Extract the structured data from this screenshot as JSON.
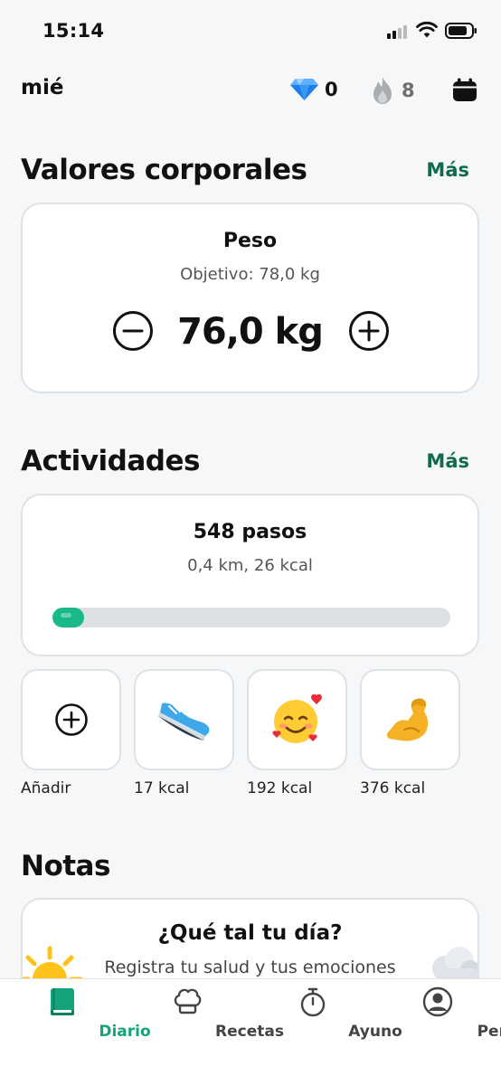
{
  "status_bar": {
    "time": "15:14"
  },
  "header": {
    "day": "mié",
    "gems": "0",
    "streak": "8"
  },
  "body_values": {
    "title": "Valores corporales",
    "more": "Más",
    "weight": {
      "title": "Peso",
      "goal": "Objetivo: 78,0 kg",
      "value": "76,0 kg"
    }
  },
  "activities": {
    "title": "Actividades",
    "more": "Más",
    "steps": {
      "title": "548 pasos",
      "subtitle": "0,4 km, 26 kcal",
      "progress_fraction": 0.08
    },
    "tiles": [
      {
        "label": "Añadir",
        "icon": "add-circle-icon"
      },
      {
        "label": "17 kcal",
        "icon": "sneaker-icon"
      },
      {
        "label": "192 kcal",
        "icon": "smiling-face-with-hearts-icon"
      },
      {
        "label": "376 kcal",
        "icon": "flexed-biceps-icon"
      }
    ]
  },
  "notes": {
    "title": "Notas",
    "card_title": "¿Qué tal tu día?",
    "card_subtitle": "Registra tu salud y tus emociones"
  },
  "tab_bar": {
    "active_color": "#14a37a",
    "tabs": [
      {
        "label": "Diario",
        "icon": "book-icon",
        "active": true
      },
      {
        "label": "Recetas",
        "icon": "chef-hat-icon",
        "active": false
      },
      {
        "label": "Ayuno",
        "icon": "stopwatch-icon",
        "active": false
      },
      {
        "label": "Perfil",
        "icon": "profile-icon",
        "active": false
      }
    ]
  },
  "colors": {
    "accent_green": "#19b98a",
    "link_green": "#116b4a",
    "background": "#f6f7f8"
  }
}
